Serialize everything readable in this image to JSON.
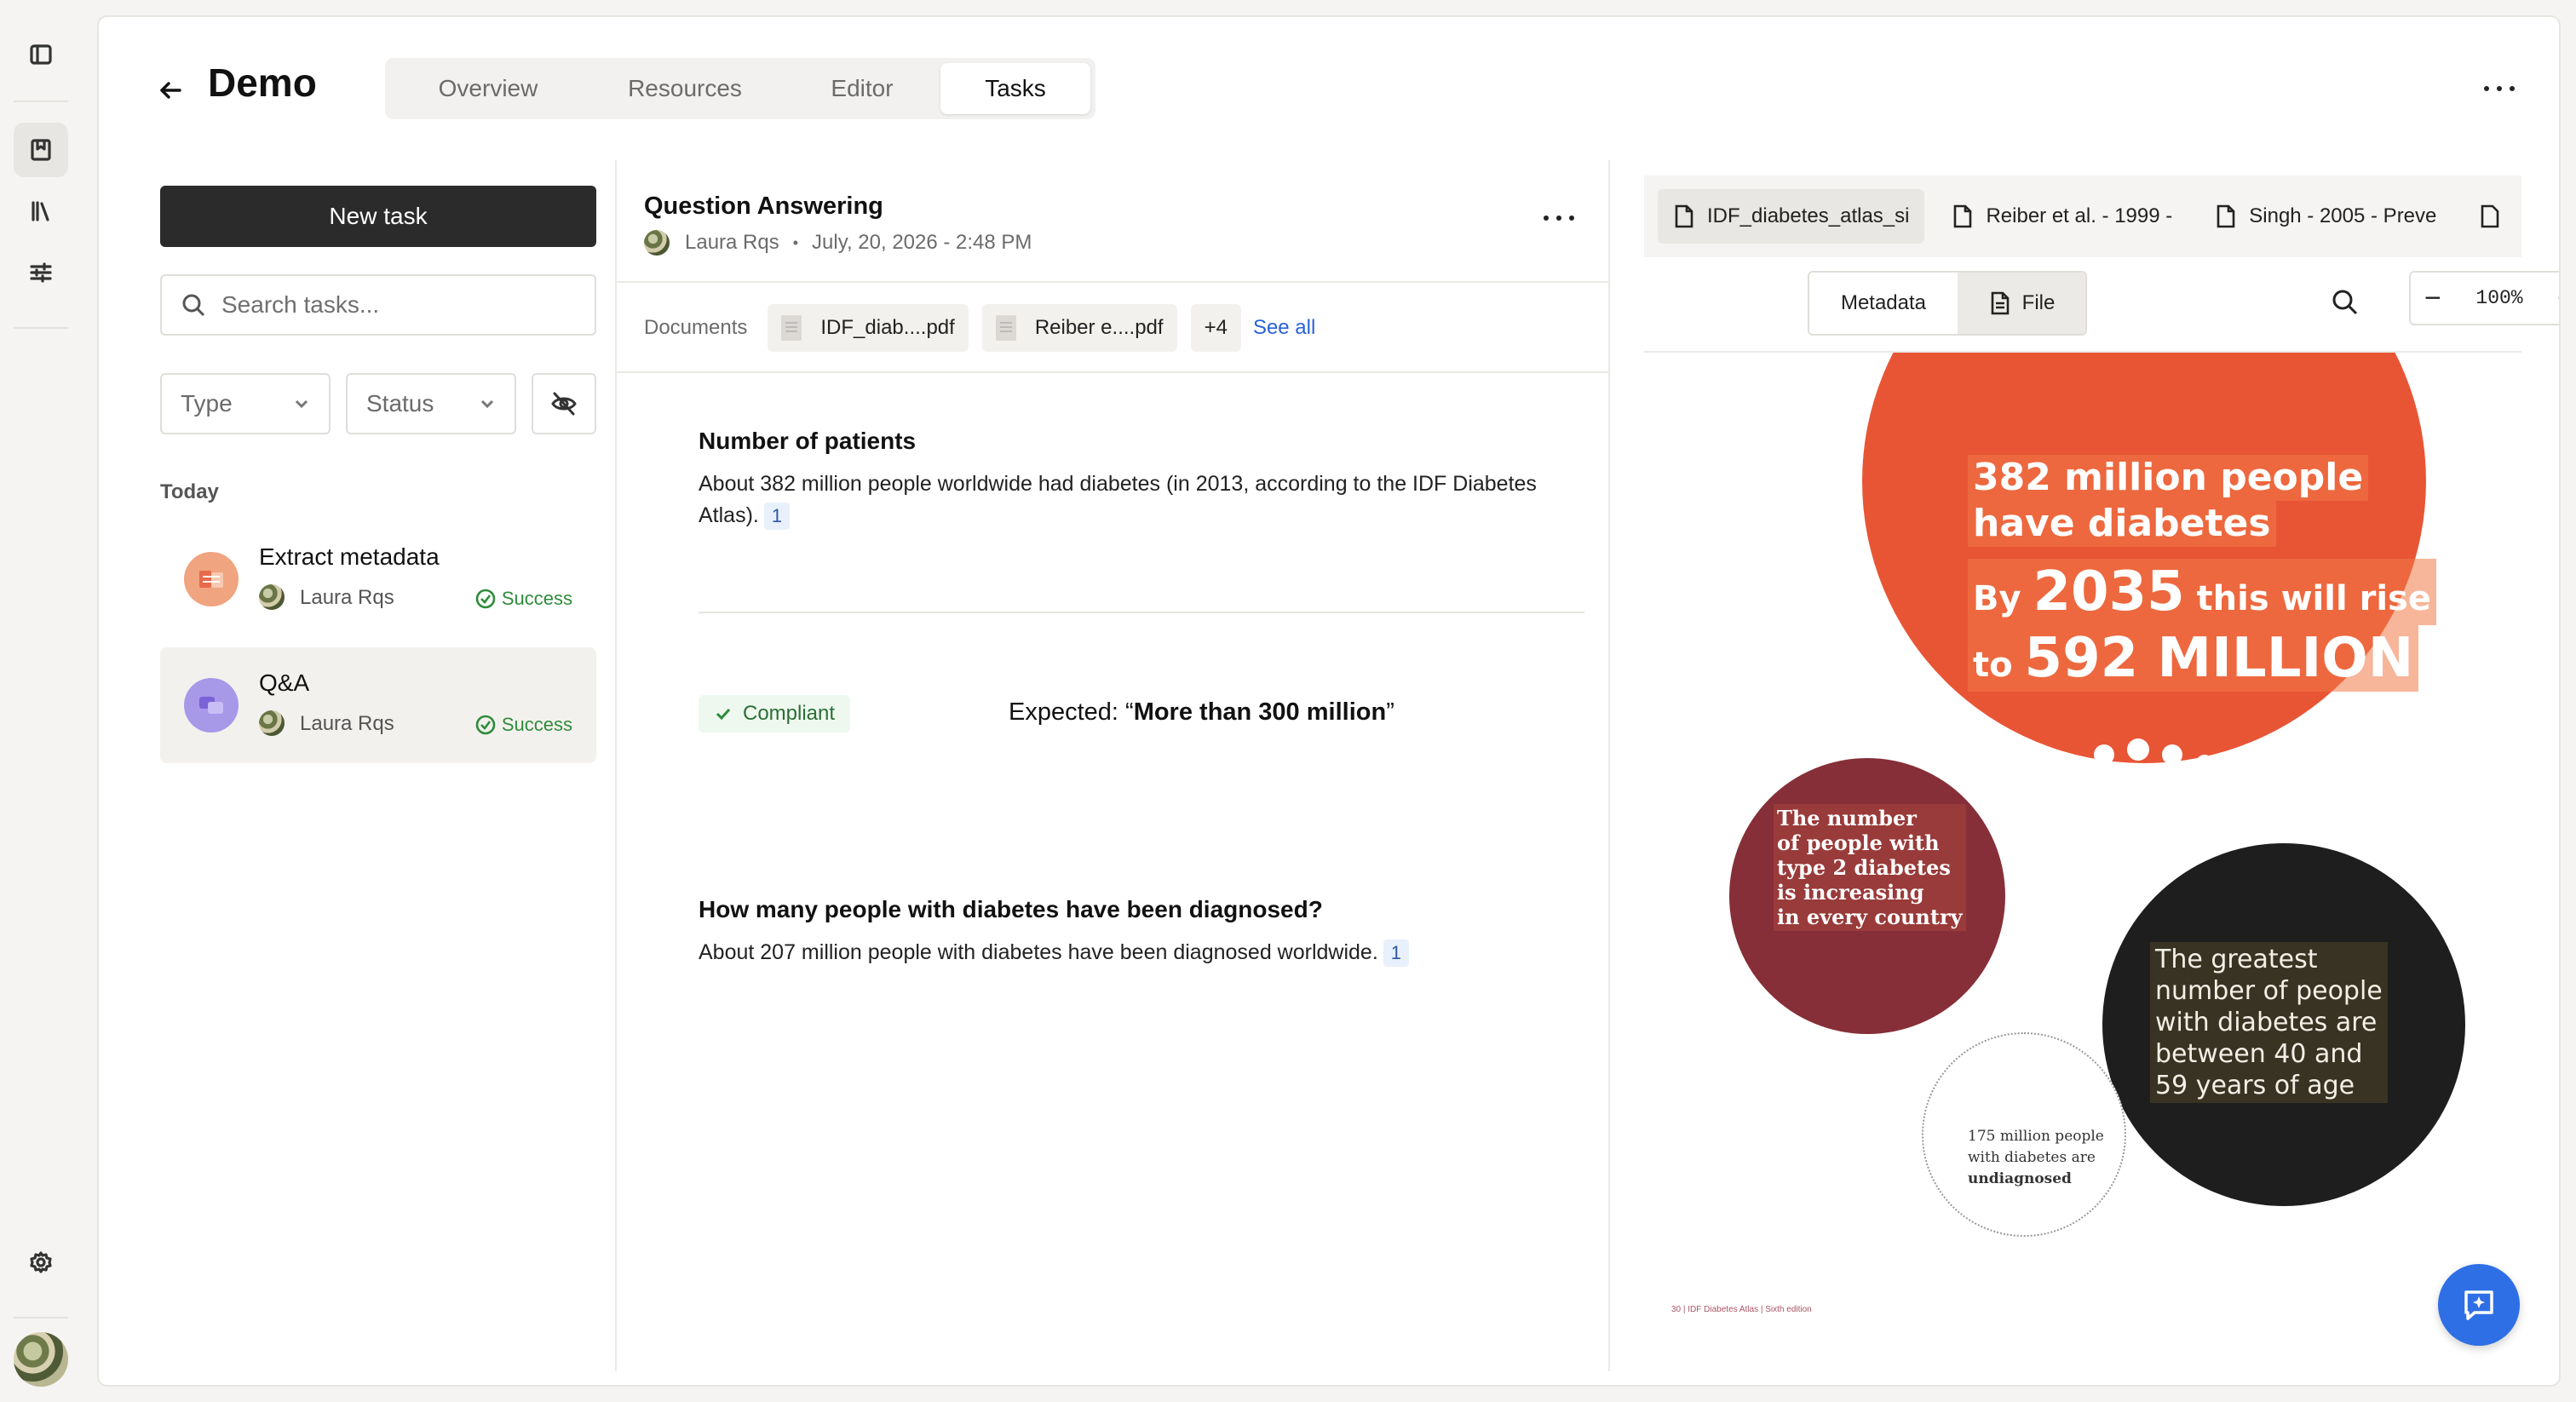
{
  "header": {
    "title": "Demo",
    "tabs": [
      "Overview",
      "Resources",
      "Editor",
      "Tasks"
    ]
  },
  "left_panel": {
    "new_task_label": "New task",
    "search_placeholder": "Search tasks...",
    "filters": {
      "type": "Type",
      "status": "Status"
    },
    "section_label": "Today",
    "tasks": [
      {
        "title": "Extract metadata",
        "user": "Laura Rqs",
        "status": "Success",
        "selected": false
      },
      {
        "title": "Q&A",
        "user": "Laura Rqs",
        "status": "Success",
        "selected": true
      }
    ]
  },
  "middle_panel": {
    "title": "Question Answering",
    "user": "Laura Rqs",
    "date": "July, 20, 2026 - 2:48 PM",
    "documents_label": "Documents",
    "documents": [
      "IDF_diab....pdf",
      "Reiber e....pdf"
    ],
    "more_count": "+4",
    "see_all": "See all",
    "qa": [
      {
        "question": "Number of patients",
        "answer": "About 382 million people worldwide had diabetes (in 2013, according to the IDF Diabetes Atlas).",
        "ref": "1"
      },
      {
        "question": "How many people with diabetes have been diagnosed?",
        "answer": "About 207 million people with diabetes have been diagnosed worldwide.",
        "ref": "1"
      }
    ],
    "compliance": {
      "badge": "Compliant",
      "expected_prefix": "Expected: “",
      "expected_value": "More than 300 million",
      "expected_suffix": "”"
    }
  },
  "right_panel": {
    "file_tabs": [
      "IDF_diabetes_atlas_si",
      "Reiber et al. - 1999 -",
      "Singh - 2005 - Preve"
    ],
    "view_toggle": {
      "metadata": "Metadata",
      "file": "File"
    },
    "zoom": "100%",
    "infographic": {
      "big_line1": "382 million people",
      "big_line2": "have diabetes",
      "big_line3_a": "By ",
      "big_line3_b": "2035",
      "big_line3_c": " this will rise",
      "big_line4_a": "to ",
      "big_line4_b": "592 MILLION",
      "maroon": [
        "The number",
        "of people with",
        "type 2 diabetes",
        "is increasing",
        "in every country"
      ],
      "black": [
        "The greatest",
        "number of people",
        "with diabetes are",
        "between 40 and",
        "59 years of age"
      ],
      "small": [
        "175 million people",
        "with diabetes are"
      ],
      "small_bold": "undiagnosed",
      "footer": "30 | IDF Diabetes Atlas | Sixth edition"
    }
  },
  "colors": {
    "accent_blue": "#2f6fe6",
    "success_green": "#2e8b3a",
    "infographic_orange": "#e85535",
    "infographic_maroon": "#862f38",
    "infographic_black": "#1e1e1e"
  }
}
